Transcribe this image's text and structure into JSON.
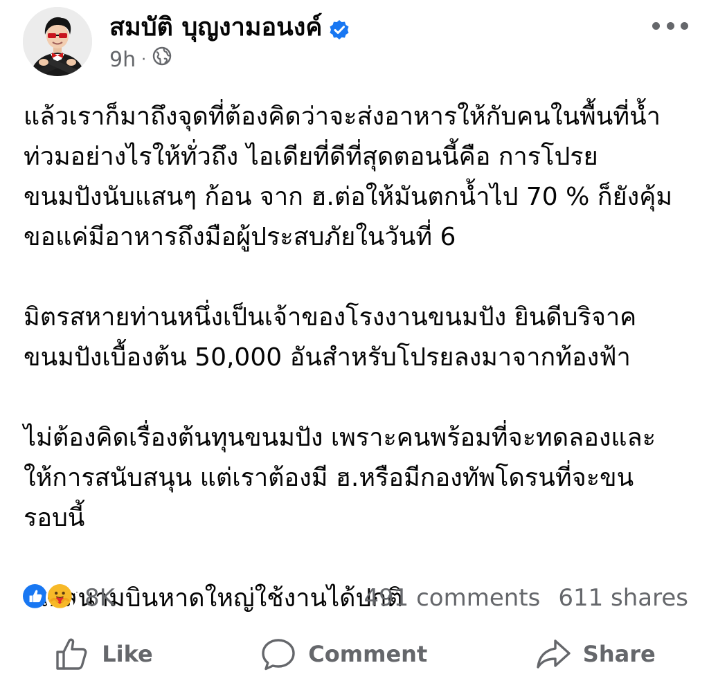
{
  "post": {
    "author": "สมบัติ บุญงามอนงค์",
    "timestamp": "9h",
    "separator": "·",
    "audience_icon": "globe-icon",
    "verified_icon": "verified-badge-icon",
    "paragraphs": [
      "แล้วเราก็มาถึงจุดที่ต้องคิดว่าจะส่งอาหารให้กับคนในพื้นที่น้ำ\nท่วมอย่างไรให้ทั่วถึง ไอเดียที่ดีที่สุดตอนนี้คือ การโปรย\nขนมปังนับแสนๆ ก้อน จาก ฮ.ต่อให้มันตกน้ำไป 70 % ก็ยังคุ้ม\nขอแค่มีอาหารถึงมือผู้ประสบภัยในวันที่ 6",
      "มิตรสหายท่านหนึ่งเป็นเจ้าของโรงงานขนมปัง ยินดีบริจาค\nขนมปังเบื้องต้น 50,000 อันสำหรับโปรยลงมาจากท้องฟ้า",
      "ไม่ต้องคิดเรื่องต้นทุนขนมปัง เพราะคนพร้อมที่จะทดลองและ\nให้การสนับสนุน แต่เราต้องมี ฮ.หรือมีกองทัพโดรนที่จะขน\nรอบนี้",
      "ปล.สนามบินหาดใหญ่ใช้งานได้ปกติ"
    ]
  },
  "stats": {
    "reactions_count": "8K",
    "reaction_icons": [
      "like-reaction-icon",
      "care-reaction-icon"
    ],
    "comments": "491 comments",
    "shares": "611 shares"
  },
  "actions": {
    "like": "Like",
    "comment": "Comment",
    "share": "Share"
  },
  "colors": {
    "text": "#050505",
    "secondary": "#65676b",
    "facebook_blue": "#1877f2",
    "care_yellow": "#f7b928"
  }
}
